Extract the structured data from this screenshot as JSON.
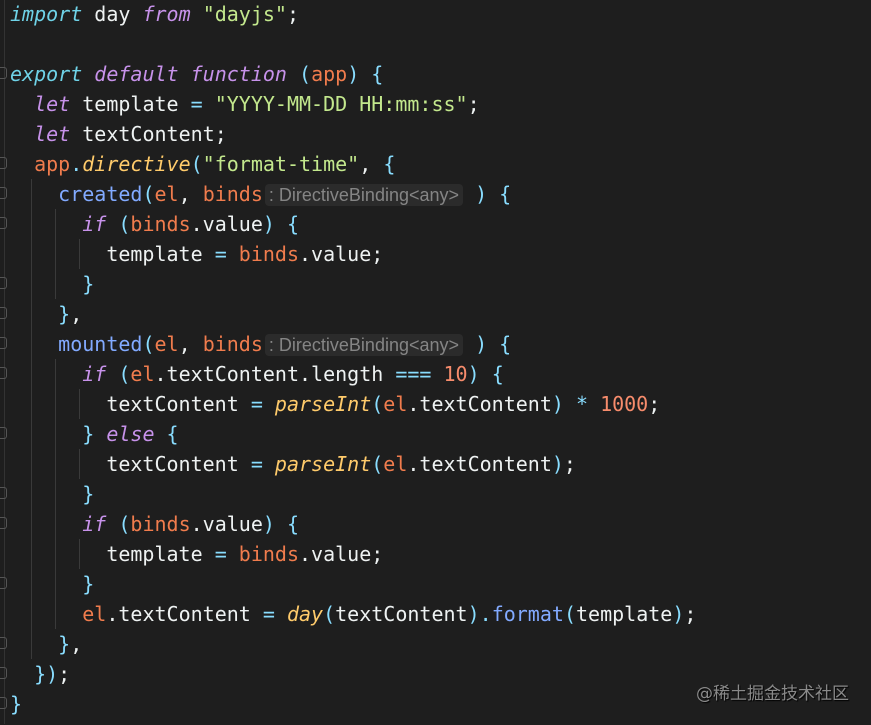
{
  "editor": {
    "colors": {
      "background": "#1e1e1e",
      "keyword": "#c792ea",
      "module_keyword": "#6fd3e8",
      "string": "#c3e88d",
      "parameter": "#f07c4d",
      "function": "#82aaff",
      "builtin": "#ffcb6b",
      "punctuation": "#89ddff"
    },
    "lines": [
      {
        "indent": 0,
        "tokens": [
          [
            "import",
            "k1"
          ],
          [
            " day ",
            "v"
          ],
          [
            "from",
            "k2"
          ],
          [
            " ",
            "v"
          ],
          [
            "\"dayjs\"",
            "s"
          ],
          [
            ";",
            "v"
          ]
        ]
      },
      {
        "indent": 0,
        "tokens": []
      },
      {
        "indent": 0,
        "fold": true,
        "tokens": [
          [
            "export",
            "k1"
          ],
          [
            " ",
            "v"
          ],
          [
            "default",
            "k2"
          ],
          [
            " ",
            "v"
          ],
          [
            "function",
            "k2"
          ],
          [
            " ",
            "v"
          ],
          [
            "(",
            "b"
          ],
          [
            "app",
            "p"
          ],
          [
            ")",
            "b"
          ],
          [
            " ",
            "v"
          ],
          [
            "{",
            "b"
          ]
        ]
      },
      {
        "indent": 1,
        "tokens": [
          [
            "let",
            "k2"
          ],
          [
            " template ",
            "v"
          ],
          [
            "=",
            "b"
          ],
          [
            " ",
            "v"
          ],
          [
            "\"YYYY-MM-DD HH:mm:ss\"",
            "s"
          ],
          [
            ";",
            "v"
          ]
        ]
      },
      {
        "indent": 1,
        "tokens": [
          [
            "let",
            "k2"
          ],
          [
            " textContent;",
            "v"
          ]
        ]
      },
      {
        "indent": 1,
        "fold": true,
        "tokens": [
          [
            "app",
            "p"
          ],
          [
            ".",
            "b"
          ],
          [
            "directive",
            "fi"
          ],
          [
            "(",
            "b"
          ],
          [
            "\"format-time\"",
            "s"
          ],
          [
            ", ",
            "v"
          ],
          [
            "{",
            "b"
          ]
        ]
      },
      {
        "indent": 2,
        "fold": true,
        "tokens": [
          [
            "created",
            "f"
          ],
          [
            "(",
            "b"
          ],
          [
            "el",
            "p"
          ],
          [
            ", ",
            "v"
          ],
          [
            "binds",
            "p"
          ],
          [
            ": DirectiveBinding<any>",
            "h"
          ],
          [
            " ",
            "v"
          ],
          [
            ")",
            "b"
          ],
          [
            " ",
            "v"
          ],
          [
            "{",
            "b"
          ]
        ]
      },
      {
        "indent": 3,
        "fold": true,
        "tokens": [
          [
            "if",
            "k2"
          ],
          [
            " ",
            "v"
          ],
          [
            "(",
            "b"
          ],
          [
            "binds",
            "p"
          ],
          [
            ".value",
            "v"
          ],
          [
            ")",
            "b"
          ],
          [
            " ",
            "v"
          ],
          [
            "{",
            "b"
          ]
        ]
      },
      {
        "indent": 4,
        "tokens": [
          [
            "template ",
            "v"
          ],
          [
            "=",
            "b"
          ],
          [
            " ",
            "v"
          ],
          [
            "binds",
            "p"
          ],
          [
            ".value;",
            "v"
          ]
        ]
      },
      {
        "indent": 3,
        "fold": true,
        "tokens": [
          [
            "}",
            "b"
          ]
        ]
      },
      {
        "indent": 2,
        "fold": true,
        "tokens": [
          [
            "}",
            "b"
          ],
          [
            ",",
            "v"
          ]
        ]
      },
      {
        "indent": 2,
        "fold": true,
        "tokens": [
          [
            "mounted",
            "f"
          ],
          [
            "(",
            "b"
          ],
          [
            "el",
            "p"
          ],
          [
            ", ",
            "v"
          ],
          [
            "binds",
            "p"
          ],
          [
            ": DirectiveBinding<any>",
            "h"
          ],
          [
            " ",
            "v"
          ],
          [
            ")",
            "b"
          ],
          [
            " ",
            "v"
          ],
          [
            "{",
            "b"
          ]
        ]
      },
      {
        "indent": 3,
        "fold": true,
        "tokens": [
          [
            "if",
            "k2"
          ],
          [
            " ",
            "v"
          ],
          [
            "(",
            "b"
          ],
          [
            "el",
            "p"
          ],
          [
            ".textContent.length ",
            "v"
          ],
          [
            "===",
            "b"
          ],
          [
            " ",
            "v"
          ],
          [
            "10",
            "n"
          ],
          [
            ")",
            "b"
          ],
          [
            " ",
            "v"
          ],
          [
            "{",
            "b"
          ]
        ]
      },
      {
        "indent": 4,
        "tokens": [
          [
            "textContent ",
            "v"
          ],
          [
            "=",
            "b"
          ],
          [
            " ",
            "v"
          ],
          [
            "parseInt",
            "fi"
          ],
          [
            "(",
            "b"
          ],
          [
            "el",
            "p"
          ],
          [
            ".textContent",
            "v"
          ],
          [
            ")",
            "b"
          ],
          [
            " ",
            "v"
          ],
          [
            "*",
            "b"
          ],
          [
            " ",
            "v"
          ],
          [
            "1000",
            "n"
          ],
          [
            ";",
            "v"
          ]
        ]
      },
      {
        "indent": 3,
        "fold": true,
        "tokens": [
          [
            "}",
            "b"
          ],
          [
            " ",
            "v"
          ],
          [
            "else",
            "k2"
          ],
          [
            " ",
            "v"
          ],
          [
            "{",
            "b"
          ]
        ]
      },
      {
        "indent": 4,
        "tokens": [
          [
            "textContent ",
            "v"
          ],
          [
            "=",
            "b"
          ],
          [
            " ",
            "v"
          ],
          [
            "parseInt",
            "fi"
          ],
          [
            "(",
            "b"
          ],
          [
            "el",
            "p"
          ],
          [
            ".textContent",
            "v"
          ],
          [
            ")",
            "b"
          ],
          [
            ";",
            "v"
          ]
        ]
      },
      {
        "indent": 3,
        "fold": true,
        "tokens": [
          [
            "}",
            "b"
          ]
        ]
      },
      {
        "indent": 3,
        "fold": true,
        "tokens": [
          [
            "if",
            "k2"
          ],
          [
            " ",
            "v"
          ],
          [
            "(",
            "b"
          ],
          [
            "binds",
            "p"
          ],
          [
            ".value",
            "v"
          ],
          [
            ")",
            "b"
          ],
          [
            " ",
            "v"
          ],
          [
            "{",
            "b"
          ]
        ]
      },
      {
        "indent": 4,
        "tokens": [
          [
            "template ",
            "v"
          ],
          [
            "=",
            "b"
          ],
          [
            " ",
            "v"
          ],
          [
            "binds",
            "p"
          ],
          [
            ".value;",
            "v"
          ]
        ]
      },
      {
        "indent": 3,
        "fold": true,
        "tokens": [
          [
            "}",
            "b"
          ]
        ]
      },
      {
        "indent": 3,
        "tokens": [
          [
            "el",
            "p"
          ],
          [
            ".textContent ",
            "v"
          ],
          [
            "=",
            "b"
          ],
          [
            " ",
            "v"
          ],
          [
            "day",
            "fi"
          ],
          [
            "(",
            "b"
          ],
          [
            "textContent",
            "v"
          ],
          [
            ")",
            "b"
          ],
          [
            ".",
            "b"
          ],
          [
            "format",
            "f"
          ],
          [
            "(",
            "b"
          ],
          [
            "template",
            "v"
          ],
          [
            ")",
            "b"
          ],
          [
            ";",
            "v"
          ]
        ]
      },
      {
        "indent": 2,
        "fold": true,
        "tokens": [
          [
            "}",
            "b"
          ],
          [
            ",",
            "v"
          ]
        ]
      },
      {
        "indent": 1,
        "fold": true,
        "tokens": [
          [
            "}",
            "b"
          ],
          [
            ")",
            "b"
          ],
          [
            ";",
            "v"
          ]
        ]
      },
      {
        "indent": 0,
        "fold": true,
        "tokens": [
          [
            "}",
            "b"
          ]
        ]
      }
    ]
  },
  "watermark": "@稀土掘金技术社区"
}
